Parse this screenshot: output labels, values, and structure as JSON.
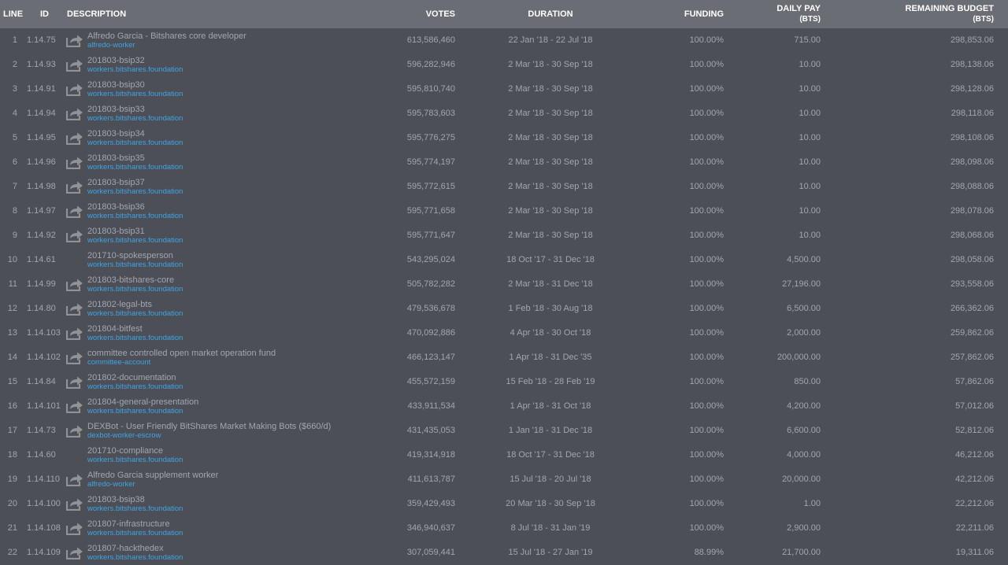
{
  "header": {
    "line": "LINE",
    "id": "ID",
    "description": "DESCRIPTION",
    "votes": "VOTES",
    "duration": "DURATION",
    "funding": "FUNDING",
    "daily_pay": "DAILY PAY",
    "daily_pay_unit": "(BTS)",
    "remaining_budget": "REMAINING BUDGET",
    "remaining_budget_unit": "(BTS)"
  },
  "colors": {
    "background": "#4c4f56",
    "header_background": "#6a6d73",
    "text": "#a3a6ab",
    "link": "#3fa4e6",
    "icon": "#8f9297"
  },
  "rows": [
    {
      "line": "1",
      "id": "1.14.75",
      "name": "Alfredo Garcia - Bitshares core developer",
      "account": "alfredo-worker",
      "votes": "613,586,460",
      "duration": "22 Jan '18 - 22 Jul '18",
      "funding": "100.00%",
      "daily_pay": "715.00",
      "remaining": "298,853.06",
      "icon": "share-icon"
    },
    {
      "line": "2",
      "id": "1.14.93",
      "name": "201803-bsip32",
      "account": "workers.bitshares.foundation",
      "votes": "596,282,946",
      "duration": "2 Mar '18 - 30 Sep '18",
      "funding": "100.00%",
      "daily_pay": "10.00",
      "remaining": "298,138.06",
      "icon": "share-icon"
    },
    {
      "line": "3",
      "id": "1.14.91",
      "name": "201803-bsip30",
      "account": "workers.bitshares.foundation",
      "votes": "595,810,740",
      "duration": "2 Mar '18 - 30 Sep '18",
      "funding": "100.00%",
      "daily_pay": "10.00",
      "remaining": "298,128.06",
      "icon": "share-icon"
    },
    {
      "line": "4",
      "id": "1.14.94",
      "name": "201803-bsip33",
      "account": "workers.bitshares.foundation",
      "votes": "595,783,603",
      "duration": "2 Mar '18 - 30 Sep '18",
      "funding": "100.00%",
      "daily_pay": "10.00",
      "remaining": "298,118.06",
      "icon": "share-icon"
    },
    {
      "line": "5",
      "id": "1.14.95",
      "name": "201803-bsip34",
      "account": "workers.bitshares.foundation",
      "votes": "595,776,275",
      "duration": "2 Mar '18 - 30 Sep '18",
      "funding": "100.00%",
      "daily_pay": "10.00",
      "remaining": "298,108.06",
      "icon": "share-icon"
    },
    {
      "line": "6",
      "id": "1.14.96",
      "name": "201803-bsip35",
      "account": "workers.bitshares.foundation",
      "votes": "595,774,197",
      "duration": "2 Mar '18 - 30 Sep '18",
      "funding": "100.00%",
      "daily_pay": "10.00",
      "remaining": "298,098.06",
      "icon": "share-icon"
    },
    {
      "line": "7",
      "id": "1.14.98",
      "name": "201803-bsip37",
      "account": "workers.bitshares.foundation",
      "votes": "595,772,615",
      "duration": "2 Mar '18 - 30 Sep '18",
      "funding": "100.00%",
      "daily_pay": "10.00",
      "remaining": "298,088.06",
      "icon": "share-icon"
    },
    {
      "line": "8",
      "id": "1.14.97",
      "name": "201803-bsip36",
      "account": "workers.bitshares.foundation",
      "votes": "595,771,658",
      "duration": "2 Mar '18 - 30 Sep '18",
      "funding": "100.00%",
      "daily_pay": "10.00",
      "remaining": "298,078.06",
      "icon": "share-icon"
    },
    {
      "line": "9",
      "id": "1.14.92",
      "name": "201803-bsip31",
      "account": "workers.bitshares.foundation",
      "votes": "595,771,647",
      "duration": "2 Mar '18 - 30 Sep '18",
      "funding": "100.00%",
      "daily_pay": "10.00",
      "remaining": "298,068.06",
      "icon": "share-icon"
    },
    {
      "line": "10",
      "id": "1.14.61",
      "name": "201710-spokesperson",
      "account": "workers.bitshares.foundation",
      "votes": "543,295,024",
      "duration": "18 Oct '17 - 31 Dec '18",
      "funding": "100.00%",
      "daily_pay": "4,500.00",
      "remaining": "298,058.06",
      "icon": ""
    },
    {
      "line": "11",
      "id": "1.14.99",
      "name": "201803-bitshares-core",
      "account": "workers.bitshares.foundation",
      "votes": "505,782,282",
      "duration": "2 Mar '18 - 31 Dec '18",
      "funding": "100.00%",
      "daily_pay": "27,196.00",
      "remaining": "293,558.06",
      "icon": "share-icon"
    },
    {
      "line": "12",
      "id": "1.14.80",
      "name": "201802-legal-bts",
      "account": "workers.bitshares.foundation",
      "votes": "479,536,678",
      "duration": "1 Feb '18 - 30 Aug '18",
      "funding": "100.00%",
      "daily_pay": "6,500.00",
      "remaining": "266,362.06",
      "icon": "share-icon"
    },
    {
      "line": "13",
      "id": "1.14.103",
      "name": "201804-bitfest",
      "account": "workers.bitshares.foundation",
      "votes": "470,092,886",
      "duration": "4 Apr '18 - 30 Oct '18",
      "funding": "100.00%",
      "daily_pay": "2,000.00",
      "remaining": "259,862.06",
      "icon": "share-icon"
    },
    {
      "line": "14",
      "id": "1.14.102",
      "name": "committee controlled open market operation fund",
      "account": "committee-account",
      "votes": "466,123,147",
      "duration": "1 Apr '18 - 31 Dec '35",
      "funding": "100.00%",
      "daily_pay": "200,000.00",
      "remaining": "257,862.06",
      "icon": "share-icon"
    },
    {
      "line": "15",
      "id": "1.14.84",
      "name": "201802-documentation",
      "account": "workers.bitshares.foundation",
      "votes": "455,572,159",
      "duration": "15 Feb '18 - 28 Feb '19",
      "funding": "100.00%",
      "daily_pay": "850.00",
      "remaining": "57,862.06",
      "icon": "share-icon"
    },
    {
      "line": "16",
      "id": "1.14.101",
      "name": "201804-general-presentation",
      "account": "workers.bitshares.foundation",
      "votes": "433,911,534",
      "duration": "1 Apr '18 - 31 Oct '18",
      "funding": "100.00%",
      "daily_pay": "4,200.00",
      "remaining": "57,012.06",
      "icon": "share-icon"
    },
    {
      "line": "17",
      "id": "1.14.73",
      "name": "DEXBot - User Friendly BitShares Market Making Bots ($660/d)",
      "account": "dexbot-worker-escrow",
      "votes": "431,435,053",
      "duration": "1 Jan '18 - 31 Dec '18",
      "funding": "100.00%",
      "daily_pay": "6,600.00",
      "remaining": "52,812.06",
      "icon": "share-icon"
    },
    {
      "line": "18",
      "id": "1.14.60",
      "name": "201710-compliance",
      "account": "workers.bitshares.foundation",
      "votes": "419,314,918",
      "duration": "18 Oct '17 - 31 Dec '18",
      "funding": "100.00%",
      "daily_pay": "4,000.00",
      "remaining": "46,212.06",
      "icon": ""
    },
    {
      "line": "19",
      "id": "1.14.110",
      "name": "Alfredo Garcia supplement worker",
      "account": "alfredo-worker",
      "votes": "411,613,787",
      "duration": "15 Jul '18 - 20 Jul '18",
      "funding": "100.00%",
      "daily_pay": "20,000.00",
      "remaining": "42,212.06",
      "icon": "share-icon"
    },
    {
      "line": "20",
      "id": "1.14.100",
      "name": "201803-bsip38",
      "account": "workers.bitshares.foundation",
      "votes": "359,429,493",
      "duration": "20 Mar '18 - 30 Sep '18",
      "funding": "100.00%",
      "daily_pay": "1.00",
      "remaining": "22,212.06",
      "icon": "share-icon"
    },
    {
      "line": "21",
      "id": "1.14.108",
      "name": "201807-infrastructure",
      "account": "workers.bitshares.foundation",
      "votes": "346,940,637",
      "duration": "8 Jul '18 - 31 Jan '19",
      "funding": "100.00%",
      "daily_pay": "2,900.00",
      "remaining": "22,211.06",
      "icon": "share-icon"
    },
    {
      "line": "22",
      "id": "1.14.109",
      "name": "201807-hackthedex",
      "account": "workers.bitshares.foundation",
      "votes": "307,059,441",
      "duration": "15 Jul '18 - 27 Jan '19",
      "funding": "88.99%",
      "daily_pay": "21,700.00",
      "remaining": "19,311.06",
      "icon": "share-icon"
    }
  ]
}
